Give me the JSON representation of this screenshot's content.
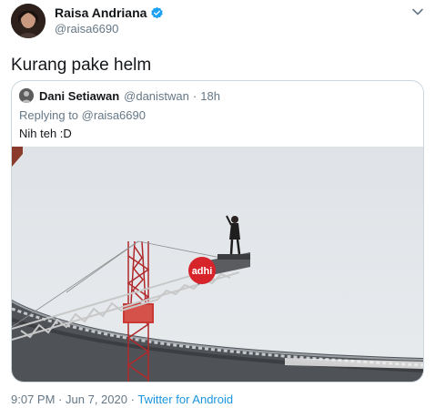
{
  "author": {
    "name": "Raisa Andriana",
    "handle": "@raisa6690",
    "verified": true,
    "avatar_icon": "profile-photo-avatar",
    "verified_icon": "verified-badge-icon",
    "verified_color": "#1da1f2"
  },
  "tweet": {
    "text": "Kurang pake helm"
  },
  "quoted": {
    "name": "Dani Setiawan",
    "handle": "@danistwan",
    "separator": "·",
    "time": "18h",
    "replying_label": "Replying to",
    "replying_to": "@raisa6690",
    "text": "Nih teh :D",
    "photo_sign_text": "adhi",
    "sign_color": "#d7242b"
  },
  "footer": {
    "time": "9:07 PM",
    "separator1": "·",
    "date": "Jun 7, 2020",
    "separator2": "·",
    "source": "Twitter for Android",
    "source_color": "#1b95e0"
  }
}
